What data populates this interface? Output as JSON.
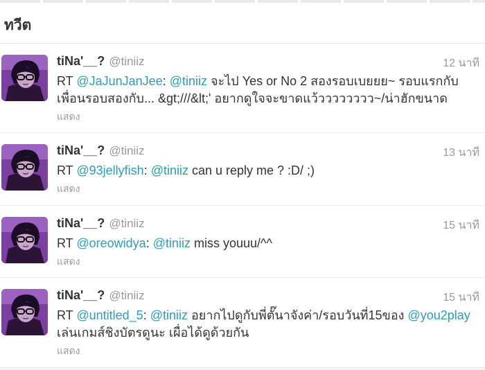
{
  "header": {
    "title": "ทวีต"
  },
  "tweets": [
    {
      "fullname": "tiNa'__?",
      "screen_name": "@tiniiz",
      "time": "12 นาที",
      "segments": [
        {
          "text": "RT ",
          "mention": false
        },
        {
          "text": "@JaJunJanJee",
          "mention": true
        },
        {
          "text": ": ",
          "mention": false
        },
        {
          "text": "@tiniiz",
          "mention": true
        },
        {
          "text": " จะไป Yes or No 2 สองรอบเบยยย~ รอบแรกกับเพื่อนรอบสองกับ... &gt;///&lt;' อยากดูใจจะขาดแว้วววววววว~/น่าฮักขนาด",
          "mention": false
        }
      ],
      "expand": "แสดง"
    },
    {
      "fullname": "tiNa'__?",
      "screen_name": "@tiniiz",
      "time": "13 นาที",
      "segments": [
        {
          "text": "RT ",
          "mention": false
        },
        {
          "text": "@93jellyfish",
          "mention": true
        },
        {
          "text": ": ",
          "mention": false
        },
        {
          "text": "@tiniiz",
          "mention": true
        },
        {
          "text": " can u reply me ? :D/ ;)",
          "mention": false
        }
      ],
      "expand": "แสดง"
    },
    {
      "fullname": "tiNa'__?",
      "screen_name": "@tiniiz",
      "time": "15 นาที",
      "segments": [
        {
          "text": "RT ",
          "mention": false
        },
        {
          "text": "@oreowidya",
          "mention": true
        },
        {
          "text": ": ",
          "mention": false
        },
        {
          "text": "@tiniiz",
          "mention": true
        },
        {
          "text": " miss youuu/^^",
          "mention": false
        }
      ],
      "expand": "แสดง"
    },
    {
      "fullname": "tiNa'__?",
      "screen_name": "@tiniiz",
      "time": "15 นาที",
      "segments": [
        {
          "text": "RT ",
          "mention": false
        },
        {
          "text": "@untitled_5",
          "mention": true
        },
        {
          "text": ": ",
          "mention": false
        },
        {
          "text": "@tiniiz",
          "mention": true
        },
        {
          "text": " อยากไปดูกับพี่ตั๊นาจังค่า/รอบวันที่15ของ ",
          "mention": false
        },
        {
          "text": "@you2play",
          "mention": true
        },
        {
          "text": " เล่นเกมส์ชิงบัตรดูนะ เผื่อได้ดูด้วยกัน",
          "mention": false
        }
      ],
      "expand": "แสดง"
    }
  ],
  "colors": {
    "mention": "#2a9fb8",
    "muted": "#999999",
    "text": "#333333",
    "divider": "#e8e8e8"
  },
  "icons": {
    "avatar": "user-avatar-photo"
  }
}
